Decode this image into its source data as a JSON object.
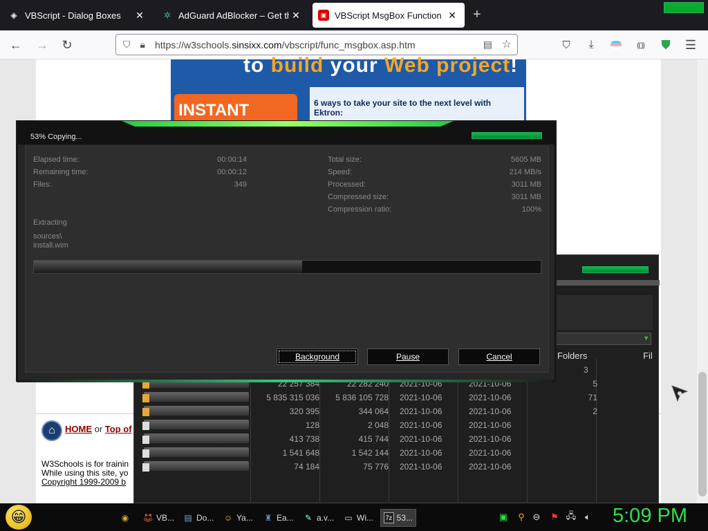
{
  "browser": {
    "tabs": [
      {
        "title": "VBScript - Dialog Boxes",
        "icon": "w3schools-icon",
        "active": false
      },
      {
        "title": "AdGuard AdBlocker – Get this E",
        "icon": "adguard-icon",
        "active": false
      },
      {
        "title": "VBScript MsgBox Function",
        "icon": "w3schools-red-icon",
        "active": true
      }
    ],
    "url": {
      "domain_prefix": "https://w3schools.",
      "domain": "sinsixx.com",
      "path": "/vbscript/func_msgbox.asp.htm"
    }
  },
  "page": {
    "banner": {
      "headline_prefix": "to ",
      "headline_orange1": "build",
      "headline_mid": " your ",
      "headline_orange2": "Web project",
      "headline_suffix": "!",
      "demo": "INSTANT DEMO",
      "ektron": "6 ways to take your site to the next level with Ektron:"
    },
    "home": {
      "home": "HOME",
      "or": " or ",
      "top": "Top of"
    },
    "footer": {
      "line1": "W3Schools is for trainin",
      "line2": "While using this site, yo",
      "line3": "Copyright 1999-2009 b"
    }
  },
  "copy_dialog": {
    "title": "53% Copying...",
    "left_stats": [
      {
        "label": "Elapsed time:",
        "value": "00:00:14"
      },
      {
        "label": "Remaining time:",
        "value": "00:00:12"
      },
      {
        "label": "Files:",
        "value": "349"
      }
    ],
    "right_stats": [
      {
        "label": "Total size:",
        "value": "5605 MB"
      },
      {
        "label": "Speed:",
        "value": "214 MB/s"
      },
      {
        "label": "Processed:",
        "value": "3011 MB"
      },
      {
        "label": "Compressed size:",
        "value": "3011 MB"
      },
      {
        "label": "Compression ratio:",
        "value": "100%"
      }
    ],
    "action": "Extracting",
    "path_line1": "sources\\",
    "path_line2": "install.wim",
    "progress": 0.53,
    "buttons": {
      "background": "Background",
      "pause": "Pause",
      "cancel": "Cancel"
    }
  },
  "file_manager": {
    "col_folders": "Folders",
    "col_files": "Fil",
    "rows": [
      {
        "size": "22 257 384",
        "packed": "22 282 240",
        "modified": "2021-10-06",
        "created": "2021-10-06",
        "folders": "5",
        "type": "folder"
      },
      {
        "size": "5 835 315 036",
        "packed": "5 836 105 728",
        "modified": "2021-10-06",
        "created": "2021-10-06",
        "folders": "71",
        "type": "folder"
      },
      {
        "size": "320 395",
        "packed": "344 064",
        "modified": "2021-10-06",
        "created": "2021-10-06",
        "folders": "2",
        "type": "folder"
      },
      {
        "size": "128",
        "packed": "2 048",
        "modified": "2021-10-06",
        "created": "2021-10-06",
        "folders": "",
        "type": "doc"
      },
      {
        "size": "413 738",
        "packed": "415 744",
        "modified": "2021-10-06",
        "created": "2021-10-06",
        "folders": "",
        "type": "doc"
      },
      {
        "size": "1 541 648",
        "packed": "1 542 144",
        "modified": "2021-10-06",
        "created": "2021-10-06",
        "folders": "",
        "type": "doc"
      },
      {
        "size": "74 184",
        "packed": "75 776",
        "modified": "2021-10-06",
        "created": "2021-10-06",
        "folders": "",
        "type": "doc"
      }
    ],
    "first_row_folders": "3"
  },
  "taskbar": {
    "items": [
      {
        "label": "",
        "icon": "chrome-icon"
      },
      {
        "label": "VB...",
        "icon": "firefox-icon"
      },
      {
        "label": "Do...",
        "icon": "document-icon"
      },
      {
        "label": "Ya...",
        "icon": "smiley-icon"
      },
      {
        "label": "Ea...",
        "icon": "app-icon"
      },
      {
        "label": "a.v...",
        "icon": "notepad-icon"
      },
      {
        "label": "Wi...",
        "icon": "window-icon"
      },
      {
        "label": "53...",
        "icon": "7zip-icon",
        "active": true
      }
    ],
    "clock": "5:09 PM"
  },
  "colors": {
    "accent_green": "#2ee04a",
    "tab_bar": "#1c1b22",
    "dialog_bg": "#2e2e2e"
  }
}
